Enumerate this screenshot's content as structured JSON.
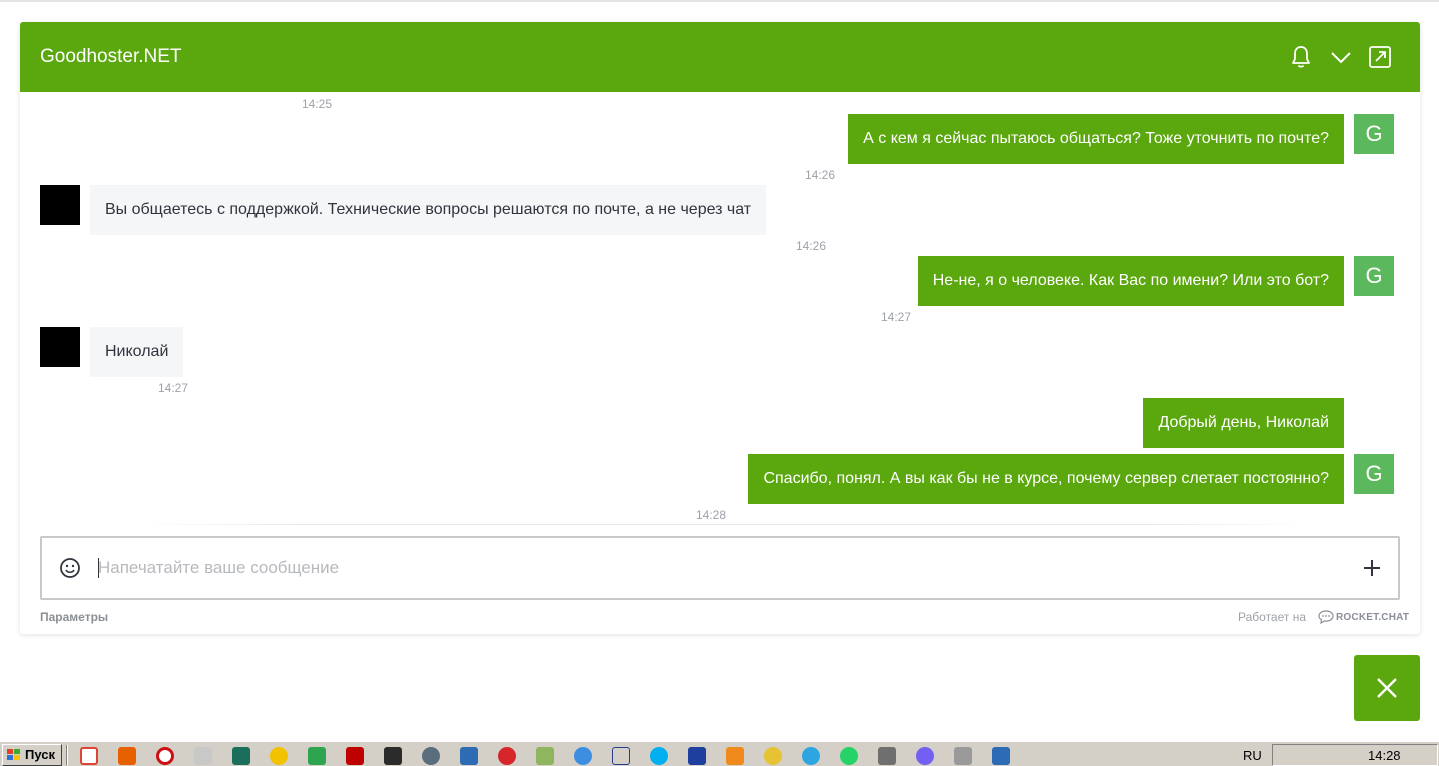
{
  "header": {
    "title": "Goodhoster.NET"
  },
  "messages": [
    {
      "dir": "time",
      "time": "14:25"
    },
    {
      "dir": "out",
      "text": "А с кем я сейчас пытаюсь общаться? Тоже уточнить по почте?",
      "time": "14:26",
      "avatar": "G"
    },
    {
      "dir": "in",
      "text": "Вы общаетесь с поддержкой. Технические вопросы решаются по почте, а не через чат",
      "time": "14:26"
    },
    {
      "dir": "out",
      "text": "Не-не, я о человеке. Как Вас по имени? Или это бот?",
      "time": "14:27",
      "avatar": "G"
    },
    {
      "dir": "in",
      "text": "Николай",
      "time": "14:27"
    },
    {
      "dir": "out",
      "text": "Добрый день, Николай"
    },
    {
      "dir": "out",
      "text": "Спасибо, понял. А вы как бы не в курсе, почему сервер слетает постоянно?",
      "time": "14:28",
      "avatar": "G"
    }
  ],
  "composer": {
    "placeholder": "Напечатайте ваше сообщение"
  },
  "footer": {
    "options_label": "Параметры",
    "powered_by": "Работает на",
    "brand": "ROCKET.CHAT"
  },
  "taskbar": {
    "start_label": "Пуск",
    "language": "RU",
    "clock": "14:28"
  }
}
